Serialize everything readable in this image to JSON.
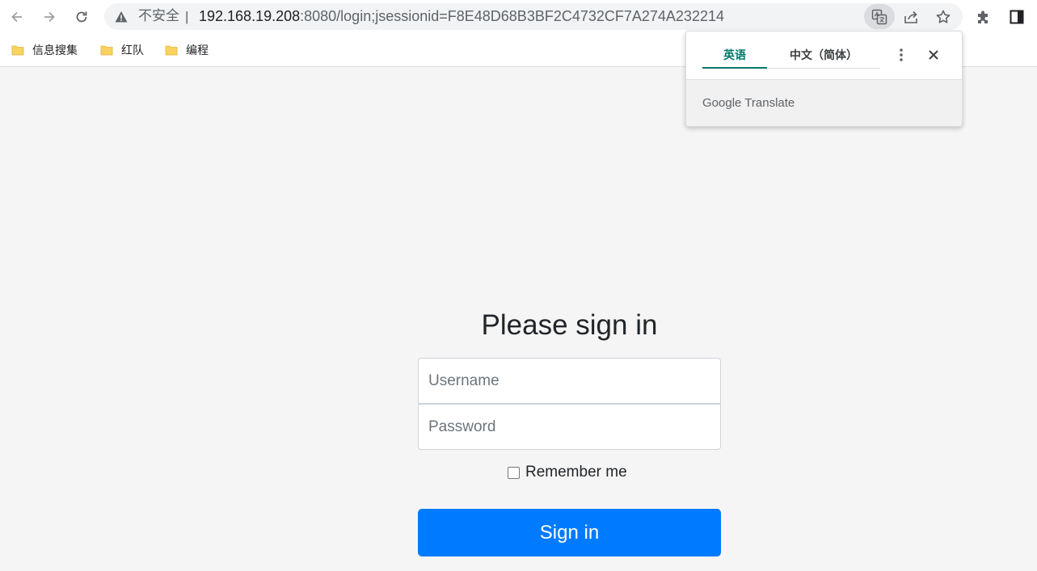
{
  "browser": {
    "omnibox": {
      "security_text": "不安全",
      "separator": "|",
      "url_host": "192.168.19.208",
      "url_rest": ":8080/login;jsessionid=F8E48D68B3BF2C4732CF7A274A232214"
    },
    "icons": {
      "back": "arrow-left-icon",
      "forward": "arrow-right-icon",
      "reload": "reload-icon",
      "warning": "warning-triangle-icon",
      "translate": "translate-icon",
      "share": "share-icon",
      "bookmark_star": "star-icon",
      "extensions": "puzzle-icon",
      "side_panel": "side-panel-icon"
    },
    "bookmarks": [
      {
        "label": "信息搜集"
      },
      {
        "label": "红队"
      },
      {
        "label": "编程"
      }
    ]
  },
  "login": {
    "heading": "Please sign in",
    "username_placeholder": "Username",
    "password_placeholder": "Password",
    "remember_label": "Remember me",
    "signin_label": "Sign in"
  },
  "translate_popup": {
    "tab_source": "英语",
    "tab_target": "中文（简体）",
    "brand_google": "Google",
    "brand_translate": "Translate"
  },
  "colors": {
    "primary": "#007bff",
    "page_bg": "#f5f5f5",
    "translate_accent": "#00796b"
  }
}
